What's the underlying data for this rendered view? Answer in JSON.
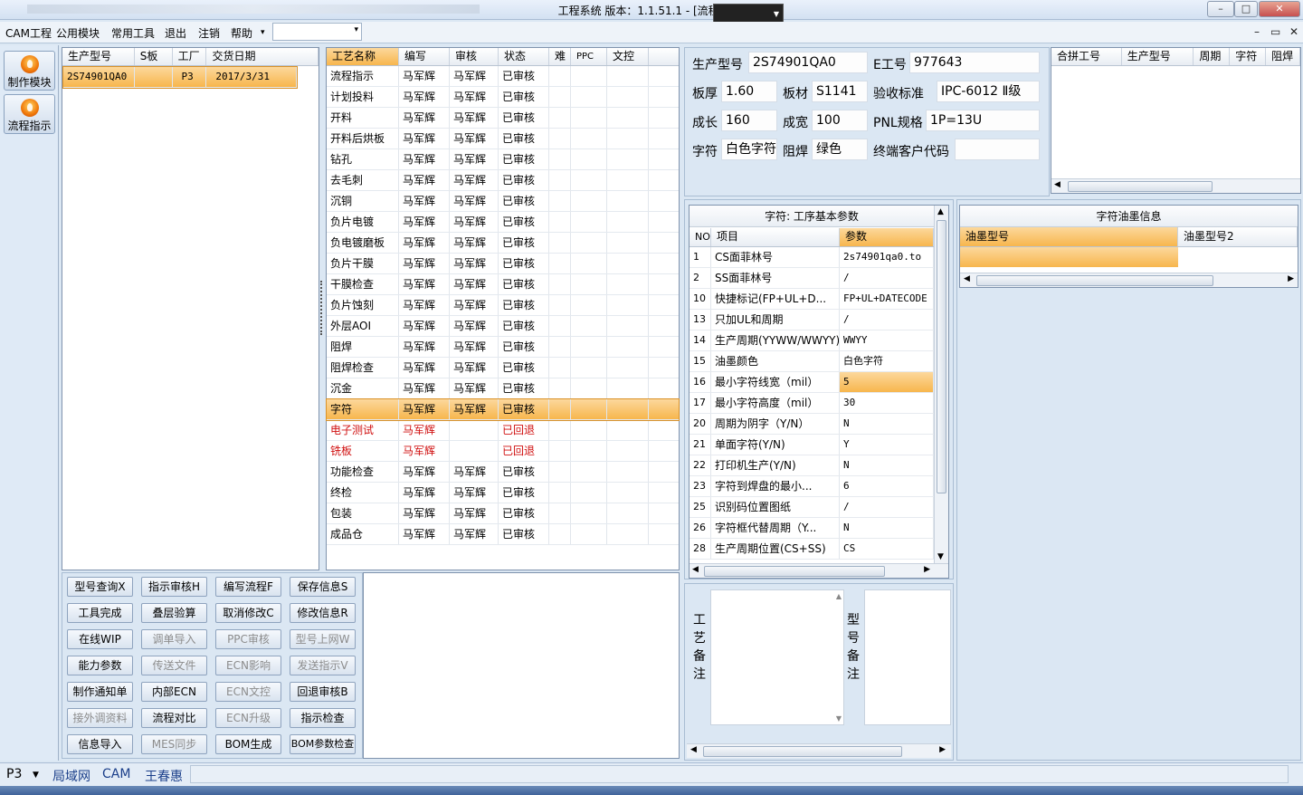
{
  "window": {
    "title": "工程系统   版本：1.1.51.1 - [流程指示]",
    "controls": [
      "–",
      "□",
      "✕"
    ]
  },
  "menubar": {
    "items": [
      "CAM工程",
      "公用模块",
      "常用工具",
      "退出",
      "注销",
      "帮助"
    ],
    "help_arrow": "▾",
    "combo_value": "",
    "mdi_controls": [
      "–",
      "▭",
      "✕"
    ]
  },
  "leftbar": {
    "items": [
      {
        "label": "制作模块",
        "icon": "fire-icon"
      },
      {
        "label": "流程指示",
        "icon": "flow-icon"
      }
    ]
  },
  "order_table": {
    "headers": [
      "生产型号",
      "S板",
      "工厂",
      "交货日期"
    ],
    "rows": [
      {
        "model": "2S74901QA0",
        "s": "",
        "factory": "P3",
        "date": "2017/3/31"
      }
    ]
  },
  "process_table": {
    "headers": [
      "工艺名称",
      "编写",
      "审核",
      "状态",
      "难",
      "PPC",
      "文控"
    ],
    "rows": [
      {
        "name": "流程指示",
        "writer": "马军辉",
        "reviewer": "马军辉",
        "status": "已审核"
      },
      {
        "name": "计划投料",
        "writer": "马军辉",
        "reviewer": "马军辉",
        "status": "已审核"
      },
      {
        "name": "开料",
        "writer": "马军辉",
        "reviewer": "马军辉",
        "status": "已审核"
      },
      {
        "name": "开料后烘板",
        "writer": "马军辉",
        "reviewer": "马军辉",
        "status": "已审核"
      },
      {
        "name": "钻孔",
        "writer": "马军辉",
        "reviewer": "马军辉",
        "status": "已审核"
      },
      {
        "name": "去毛刺",
        "writer": "马军辉",
        "reviewer": "马军辉",
        "status": "已审核"
      },
      {
        "name": "沉铜",
        "writer": "马军辉",
        "reviewer": "马军辉",
        "status": "已审核"
      },
      {
        "name": "负片电镀",
        "writer": "马军辉",
        "reviewer": "马军辉",
        "status": "已审核"
      },
      {
        "name": "负电镀磨板",
        "writer": "马军辉",
        "reviewer": "马军辉",
        "status": "已审核"
      },
      {
        "name": "负片干膜",
        "writer": "马军辉",
        "reviewer": "马军辉",
        "status": "已审核"
      },
      {
        "name": "干膜检查",
        "writer": "马军辉",
        "reviewer": "马军辉",
        "status": "已审核"
      },
      {
        "name": "负片蚀刻",
        "writer": "马军辉",
        "reviewer": "马军辉",
        "status": "已审核"
      },
      {
        "name": "外层AOI",
        "writer": "马军辉",
        "reviewer": "马军辉",
        "status": "已审核"
      },
      {
        "name": "阻焊",
        "writer": "马军辉",
        "reviewer": "马军辉",
        "status": "已审核"
      },
      {
        "name": "阻焊检查",
        "writer": "马军辉",
        "reviewer": "马军辉",
        "status": "已审核"
      },
      {
        "name": "沉金",
        "writer": "马军辉",
        "reviewer": "马军辉",
        "status": "已审核"
      },
      {
        "name": "字符",
        "writer": "马军辉",
        "reviewer": "马军辉",
        "status": "已审核",
        "selected": true
      },
      {
        "name": "电子测试",
        "writer": "马军辉",
        "reviewer": "",
        "status": "已回退",
        "returned": true
      },
      {
        "name": "铣板",
        "writer": "马军辉",
        "reviewer": "",
        "status": "已回退",
        "returned": true
      },
      {
        "name": "功能检查",
        "writer": "马军辉",
        "reviewer": "马军辉",
        "status": "已审核"
      },
      {
        "name": "终检",
        "writer": "马军辉",
        "reviewer": "马军辉",
        "status": "已审核"
      },
      {
        "name": "包装",
        "writer": "马军辉",
        "reviewer": "马军辉",
        "status": "已审核"
      },
      {
        "name": "成品仓",
        "writer": "马军辉",
        "reviewer": "马军辉",
        "status": "已审核"
      }
    ]
  },
  "buttons": [
    [
      {
        "label": "型号查询X",
        "enabled": true
      },
      {
        "label": "指示审核H",
        "enabled": true
      },
      {
        "label": "编写流程F",
        "enabled": true
      },
      {
        "label": "保存信息S",
        "enabled": true
      }
    ],
    [
      {
        "label": "工具完成",
        "enabled": true
      },
      {
        "label": "叠层验算",
        "enabled": true
      },
      {
        "label": "取消修改C",
        "enabled": true
      },
      {
        "label": "修改信息R",
        "enabled": true
      }
    ],
    [
      {
        "label": "在线WIP",
        "enabled": true
      },
      {
        "label": "调单导入",
        "enabled": false
      },
      {
        "label": "PPC审核",
        "enabled": false
      },
      {
        "label": "型号上网W",
        "enabled": false
      }
    ],
    [
      {
        "label": "能力参数",
        "enabled": true
      },
      {
        "label": "传送文件",
        "enabled": false
      },
      {
        "label": "ECN影响",
        "enabled": false
      },
      {
        "label": "发送指示V",
        "enabled": false
      }
    ],
    [
      {
        "label": "制作通知单",
        "enabled": true
      },
      {
        "label": "内部ECN",
        "enabled": true
      },
      {
        "label": "ECN文控",
        "enabled": false
      },
      {
        "label": "回退审核B",
        "enabled": true
      }
    ],
    [
      {
        "label": "接外调资料",
        "enabled": false
      },
      {
        "label": "流程对比",
        "enabled": true
      },
      {
        "label": "ECN升级",
        "enabled": false
      },
      {
        "label": "指示检查",
        "enabled": true
      }
    ],
    [
      {
        "label": "信息导入",
        "enabled": true
      },
      {
        "label": "MES同步",
        "enabled": false
      },
      {
        "label": "BOM生成",
        "enabled": true
      },
      {
        "label": "BOM参数检查",
        "enabled": true
      }
    ]
  ],
  "info": {
    "model_label": "生产型号",
    "model_value": "2S74901QA0",
    "eno_label": "E工号",
    "eno_value": "977643",
    "thickness_label": "板厚",
    "thickness_value": "1.60",
    "material_label": "板材",
    "material_value": "S1141",
    "standard_label": "验收标准",
    "standard_value": "IPC-6012 Ⅱ级",
    "length_label": "成长",
    "length_value": "160",
    "width_label": "成宽",
    "width_value": "100",
    "pnl_label": "PNL规格",
    "pnl_value": "1P=13U",
    "char_label": "字符",
    "char_value": "白色字符",
    "mask_label": "阻焊",
    "mask_value": "绿色",
    "customer_label": "终端客户代码",
    "customer_value": ""
  },
  "merge_table": {
    "headers": [
      "合拼工号",
      "生产型号",
      "周期",
      "字符",
      "阻焊"
    ]
  },
  "param_table": {
    "title": "字符: 工序基本参数",
    "headers": [
      "NO",
      "项目",
      "参数"
    ],
    "rows": [
      {
        "no": "1",
        "item": "CS面菲林号",
        "value": "2s74901qa0.to"
      },
      {
        "no": "2",
        "item": "SS面菲林号",
        "value": "/"
      },
      {
        "no": "10",
        "item": "快捷标记(FP+UL+D...",
        "value": "FP+UL+DATECODE"
      },
      {
        "no": "13",
        "item": "只加UL和周期",
        "value": "/"
      },
      {
        "no": "14",
        "item": "生产周期(YYWW/WWYY)",
        "value": "WWYY"
      },
      {
        "no": "15",
        "item": "油墨颜色",
        "value": "白色字符"
      },
      {
        "no": "16",
        "item": "最小字符线宽（mil）",
        "value": "5",
        "selected": true
      },
      {
        "no": "17",
        "item": "最小字符高度（mil）",
        "value": "30"
      },
      {
        "no": "20",
        "item": "周期为阴字（Y/N）",
        "value": "N"
      },
      {
        "no": "21",
        "item": "单面字符(Y/N)",
        "value": "Y"
      },
      {
        "no": "22",
        "item": "打印机生产(Y/N)",
        "value": "N"
      },
      {
        "no": "23",
        "item": "字符到焊盘的最小...",
        "value": "6"
      },
      {
        "no": "25",
        "item": "识别码位置图纸",
        "value": "/"
      },
      {
        "no": "26",
        "item": "字符框代替周期（Y...",
        "value": "N"
      },
      {
        "no": "28",
        "item": "生产周期位置(CS+SS)",
        "value": "CS"
      }
    ]
  },
  "ink_table": {
    "title": "字符油墨信息",
    "headers": [
      "油墨型号",
      "油墨型号2"
    ]
  },
  "remarks": {
    "process_label": [
      "工",
      "艺",
      "备",
      "注"
    ],
    "model_label": [
      "型",
      "号",
      "备",
      "注"
    ]
  },
  "statusbar": {
    "factory": "P3",
    "network": "局域网",
    "module": "CAM",
    "user": "王春惠"
  }
}
